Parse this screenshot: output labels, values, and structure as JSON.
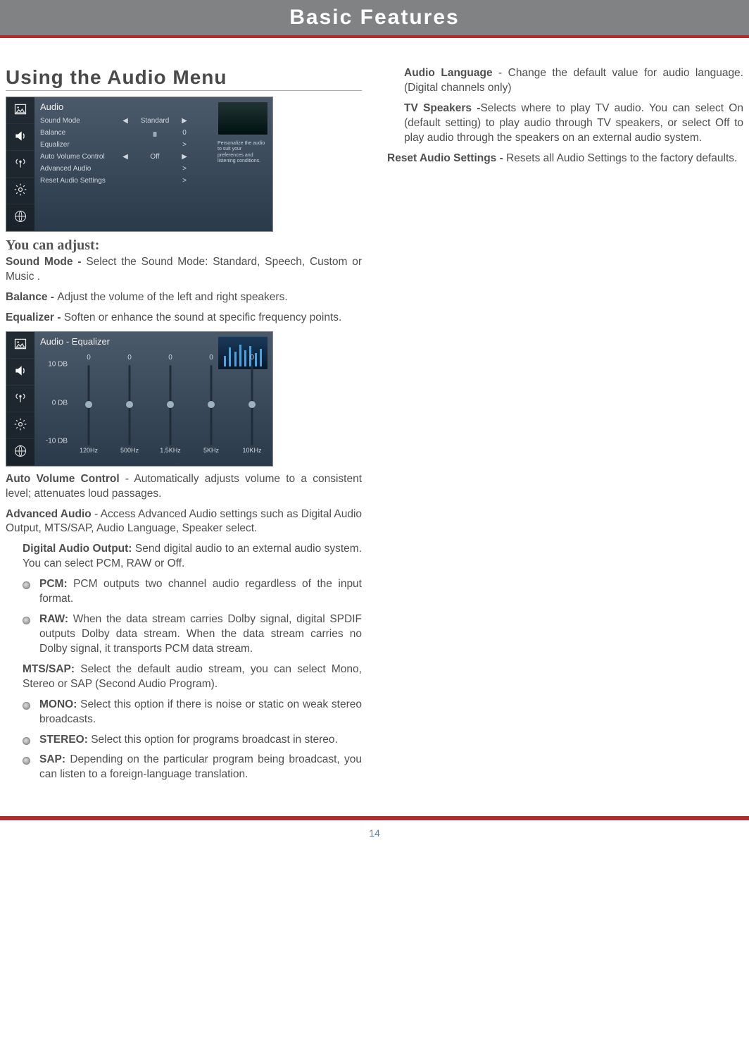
{
  "header": {
    "title": "Basic Features"
  },
  "page_number": "14",
  "left": {
    "section_title": "Using the Audio Menu",
    "you_can_adjust": "You can adjust:",
    "sound_mode": {
      "label": "Sound Mode - ",
      "text": "Select the Sound Mode: Standard, Speech, Custom or Music ."
    },
    "balance": {
      "label": "Balance - ",
      "text": "Adjust the volume of the left and right speakers."
    },
    "equalizer": {
      "label": "Equalizer - ",
      "text": "Soften or enhance the sound at specific frequency points."
    },
    "avc": {
      "label": "Auto Volume Control",
      "sep": " - ",
      "text": "Automatically adjusts volume to a consistent level; attenuates loud passages."
    },
    "advaudio": {
      "label": "Advanced Audio",
      "sep": " - ",
      "text": "Access Advanced Audio settings such as Digital Audio Output, MTS/SAP, Audio Language, Speaker select."
    },
    "dao": {
      "label": "Digital Audio Output: ",
      "text": "Send digital audio to an external audio system. You can select PCM, RAW or Off."
    },
    "pcm": {
      "label": "PCM: ",
      "text": "PCM outputs two channel audio regardless of the input format."
    },
    "raw": {
      "label": "RAW: ",
      "text": "When the data stream carries Dolby signal, digital SPDIF outputs Dolby data stream. When the data stream carries no Dolby signal, it transports PCM data stream."
    },
    "mts": {
      "label": "MTS/SAP: ",
      "text": "Select the default audio stream, you can select Mono, Stereo or SAP (Second Audio Program)."
    },
    "mono": {
      "label": "MONO: ",
      "text": "Select this option if there is noise or static on weak stereo broadcasts."
    },
    "stereo": {
      "label": "STEREO: ",
      "text": "Select this option for programs broadcast in stereo."
    },
    "sap": {
      "label": "SAP: ",
      "text": "Depending on the particular program being broadcast, you can listen to a foreign-language translation."
    }
  },
  "right": {
    "audio_lang": {
      "label": "Audio Language",
      "sep": " - ",
      "text": "Change the default value for audio language. (Digital channels only)"
    },
    "speakers": {
      "label": "TV Speakers -",
      "text": "Selects where to play TV audio. You can select On (default setting) to play audio through TV speakers, or select Off to play audio through the speakers on an external audio system."
    },
    "reset": {
      "label": "Reset Audio Settings - ",
      "text": "Resets all Audio Settings to the factory defaults."
    }
  },
  "osd_audio": {
    "title": "Audio",
    "help_text": "Personalize the audio to suit your preferences and listening conditions.",
    "rows": {
      "sound_mode": {
        "label": "Sound Mode",
        "value": "Standard",
        "left": "◀",
        "right": "▶"
      },
      "balance": {
        "label": "Balance",
        "value_num": "0"
      },
      "equalizer": {
        "label": "Equalizer",
        "chev": ">"
      },
      "avc": {
        "label": "Auto Volume Control",
        "value": "Off",
        "left": "◀",
        "right": "▶"
      },
      "advaudio": {
        "label": "Advanced Audio",
        "chev": ">"
      },
      "reset": {
        "label": "Reset Audio Settings",
        "chev": ">"
      }
    }
  },
  "osd_eq": {
    "title": "Audio - Equalizer"
  },
  "chart_data": {
    "type": "bar",
    "title": "Audio - Equalizer",
    "categories": [
      "120Hz",
      "500Hz",
      "1.5KHz",
      "5KHz",
      "10KHz"
    ],
    "values": [
      0,
      0,
      0,
      0,
      0
    ],
    "ylabel": "dB",
    "ylim": [
      -10,
      10
    ],
    "yticks": [
      {
        "label": "10 DB",
        "value": 10
      },
      {
        "label": "0 DB",
        "value": 0
      },
      {
        "label": "-10 DB",
        "value": -10
      }
    ]
  }
}
